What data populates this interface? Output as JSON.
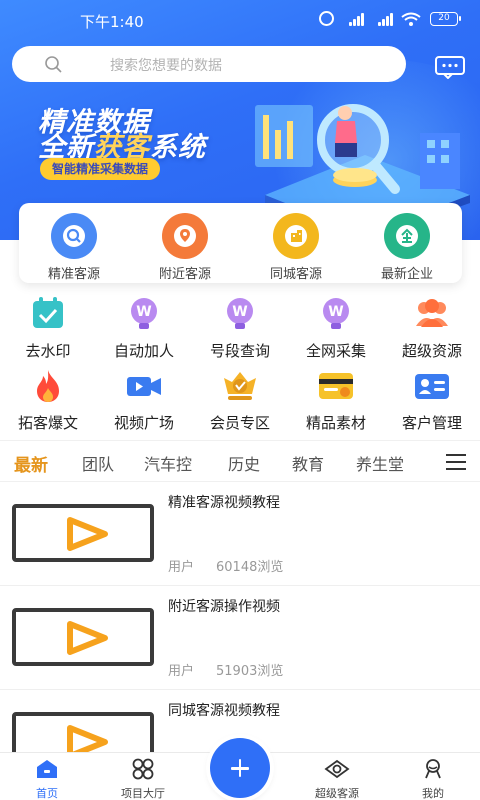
{
  "status_bar": {
    "time": "下午1:40",
    "battery": "20"
  },
  "search": {
    "placeholder": "搜索您想要的数据"
  },
  "banner": {
    "line1": "精准数据",
    "line2_a": "全新",
    "line2_highlight": "获客",
    "line2_b": "系统",
    "tag": "智能精准采集数据"
  },
  "quick_actions": [
    {
      "label": "精准客源",
      "icon": "search-icon",
      "color": "#4a8af5"
    },
    {
      "label": "附近客源",
      "icon": "location-icon",
      "color": "#f47a3a"
    },
    {
      "label": "同城客源",
      "icon": "building-icon",
      "color": "#f3b71d"
    },
    {
      "label": "最新企业",
      "icon": "enterprise-icon",
      "color": "#26b589"
    }
  ],
  "grid_row1": [
    {
      "label": "去水印",
      "icon": "calendar-check-icon"
    },
    {
      "label": "自动加人",
      "icon": "wechat-bulb-icon"
    },
    {
      "label": "号段查询",
      "icon": "wechat-bulb-icon"
    },
    {
      "label": "全网采集",
      "icon": "wechat-bulb-icon"
    },
    {
      "label": "超级资源",
      "icon": "people-icon"
    }
  ],
  "grid_row2": [
    {
      "label": "拓客爆文",
      "icon": "fire-icon"
    },
    {
      "label": "视频广场",
      "icon": "video-camera-icon"
    },
    {
      "label": "会员专区",
      "icon": "vip-badge-icon"
    },
    {
      "label": "精品素材",
      "icon": "material-icon"
    },
    {
      "label": "客户管理",
      "icon": "contact-card-icon"
    }
  ],
  "tabs": [
    "最新",
    "团队",
    "汽车控",
    "历史",
    "教育",
    "养生堂"
  ],
  "videos": [
    {
      "title": "精准客源视频教程",
      "user": "用户",
      "views": "60148浏览"
    },
    {
      "title": "附近客源操作视频",
      "user": "用户",
      "views": "51903浏览"
    },
    {
      "title": "同城客源视频教程",
      "user": "",
      "views": ""
    }
  ],
  "bottom_nav": [
    {
      "label": "首页",
      "icon": "home-icon"
    },
    {
      "label": "项目大厅",
      "icon": "grid-apps-icon"
    },
    {
      "label": "超级客源",
      "icon": "eye-icon"
    },
    {
      "label": "我的",
      "icon": "user-icon"
    }
  ],
  "colors": {
    "primary": "#2f6ff7",
    "active_tab": "#e5951d",
    "tag_bg": "#ffcb2f"
  }
}
